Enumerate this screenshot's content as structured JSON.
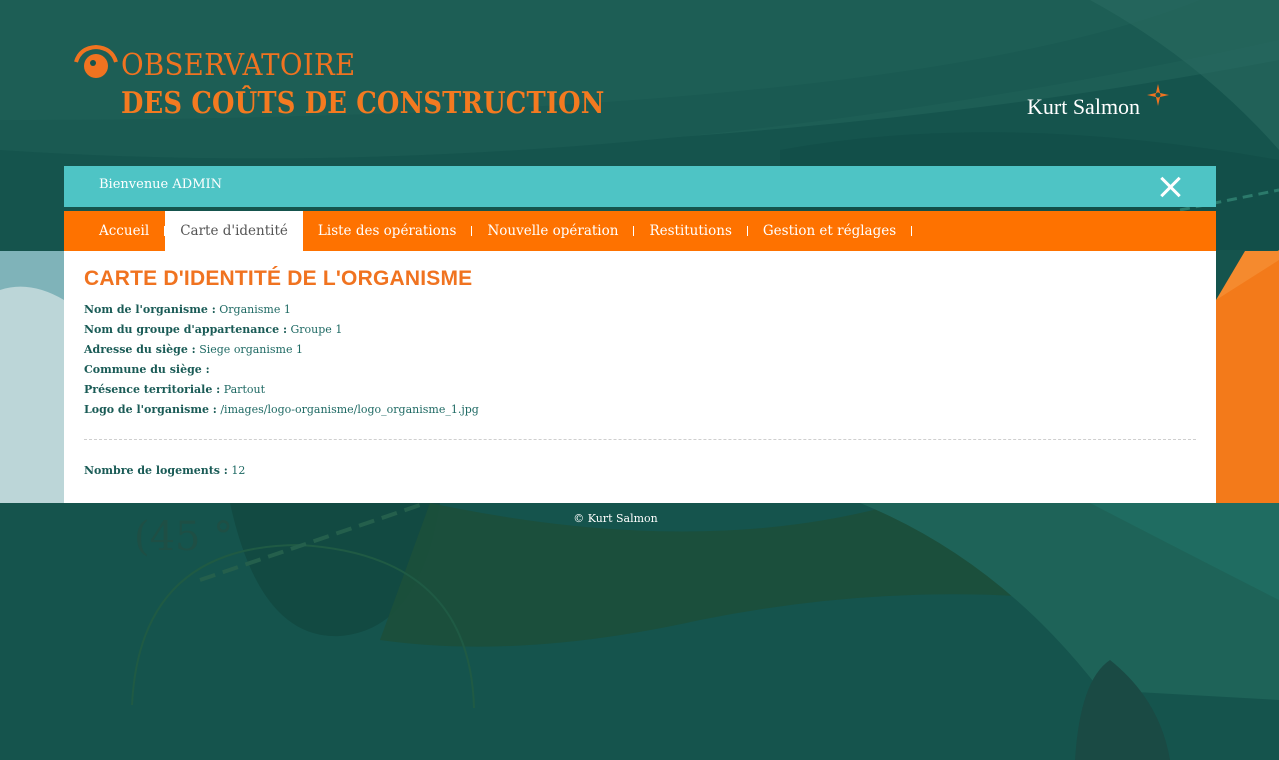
{
  "header": {
    "logo_line1": "OBSERVATOIRE",
    "logo_line2": "DES COÛTS DE CONSTRUCTION",
    "brand": "Kurt Salmon"
  },
  "welcome_bar": {
    "text": "Bienvenue ADMIN"
  },
  "nav": {
    "items": [
      {
        "label": "Accueil",
        "active": false
      },
      {
        "label": "Carte d'identité",
        "active": true
      },
      {
        "label": "Liste des opérations",
        "active": false
      },
      {
        "label": "Nouvelle opération",
        "active": false
      },
      {
        "label": "Restitutions",
        "active": false
      },
      {
        "label": "Gestion et réglages",
        "active": false
      }
    ]
  },
  "main": {
    "title": "CARTE D'IDENTITÉ DE L'ORGANISME",
    "fields": [
      {
        "label": "Nom de l'organisme :",
        "value": "Organisme 1"
      },
      {
        "label": "Nom du groupe d'appartenance :",
        "value": "Groupe 1"
      },
      {
        "label": "Adresse du siège :",
        "value": "Siege organisme 1"
      },
      {
        "label": "Commune du siège :",
        "value": ""
      },
      {
        "label": "Présence territoriale :",
        "value": "Partout"
      },
      {
        "label": "Logo de l'organisme :",
        "value": "/images/logo-organisme/logo_organisme_1.jpg"
      }
    ],
    "housing": {
      "label": "Nombre de logements :",
      "value": "12"
    }
  },
  "footer": {
    "text": "© Kurt Salmon"
  },
  "decor": {
    "angle_text": "(45 °"
  },
  "colors": {
    "background": "#15544d",
    "accent_orange": "#fe7200",
    "title_orange": "#f07320",
    "welcome_teal": "#4ec4c5",
    "text_teal": "#1a5b56"
  }
}
